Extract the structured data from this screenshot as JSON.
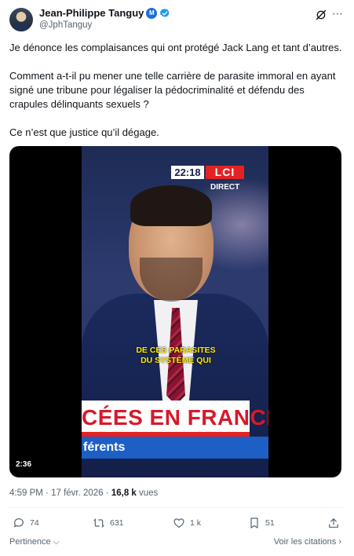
{
  "author": {
    "display_name": "Jean-Philippe Tanguy",
    "handle": "@JphTanguy",
    "badge_letter": "M"
  },
  "tweet": {
    "paragraphs": [
      "Je dénonce les complaisances qui ont protégé Jack Lang et tant d’autres.",
      "Comment a-t-il pu mener une telle carrière de parasite immoral en ayant signé une tribune pour légaliser la pédocriminalité et défendu des crapules délinquants sexuels ?",
      "Ce n’est que justice qu’il dégage."
    ]
  },
  "video": {
    "clock": "22:18",
    "channel": "LCI",
    "live_label": "DIRECT",
    "subtitle_line1": "DE CES PARASITES",
    "subtitle_line2": "DU SYSTÈME QUI",
    "banner_main": "CÉES EN FRANCE",
    "banner_sub": "férents",
    "duration": "2:36"
  },
  "meta": {
    "time": "4:59 PM",
    "separator": "·",
    "date": "17 févr. 2026",
    "views_count": "16,8 k",
    "views_label": "vues"
  },
  "actions": {
    "replies": "74",
    "reposts": "631",
    "likes": "1 k",
    "bookmarks": "51"
  },
  "footer": {
    "sort_label": "Pertinence",
    "quotes_label": "Voir les citations"
  },
  "colors": {
    "text": "#0f1419",
    "muted": "#536471",
    "verified": "#1d9bf0",
    "lci_red": "#e32323"
  }
}
